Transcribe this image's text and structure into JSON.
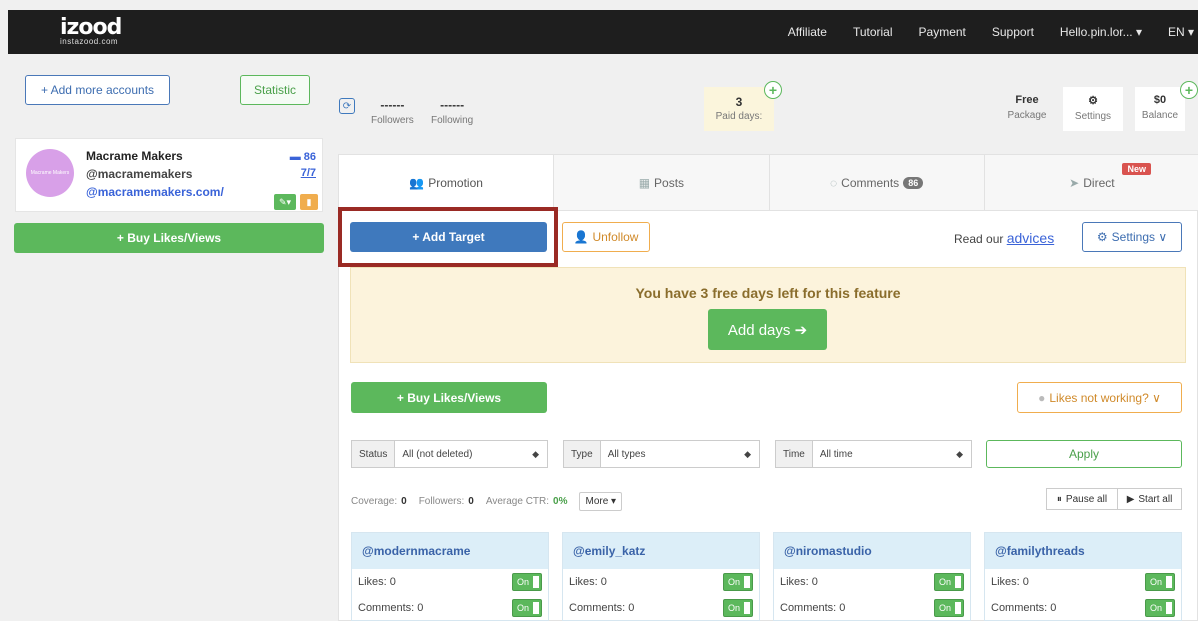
{
  "brand": {
    "logo": "izood",
    "site": "instazood.com"
  },
  "nav": {
    "affiliate": "Affiliate",
    "tutorial": "Tutorial",
    "payment": "Payment",
    "support": "Support",
    "user": "Hello.pin.lor... ▾",
    "lang": "EN ▾"
  },
  "left": {
    "add_accounts": "+ Add more accounts",
    "statistic": "Statistic",
    "account": {
      "avatar_text": "Macrame Makers",
      "name": "Macrame Makers",
      "handle": "@macramemakers",
      "link": "@macramemakers.com/",
      "messages": "86",
      "ratio": "7/7"
    },
    "buy_likes": "+ Buy Likes/Views"
  },
  "stats": {
    "followers_value": "------",
    "followers_label": "Followers",
    "following_value": "------",
    "following_label": "Following",
    "paid_value": "3",
    "paid_label": "Paid days:",
    "package_value": "Free",
    "package_label": "Package",
    "settings_label": "Settings",
    "balance_value": "$0",
    "balance_label": "Balance"
  },
  "tabs": {
    "promotion": "Promotion",
    "posts": "Posts",
    "comments": "Comments",
    "comments_count": "86",
    "direct": "Direct",
    "new_badge": "New"
  },
  "toolbar": {
    "add_target": "+ Add Target",
    "unfollow": "Unfollow",
    "read_our": "Read our",
    "advices": "advices",
    "settings": "Settings ∨"
  },
  "notice": {
    "text": "You have 3 free days left for this feature",
    "add_days": "Add days ➔"
  },
  "buy_likes_main": "+ Buy Likes/Views",
  "likes_not_working": "Likes not working? ∨",
  "filters": {
    "status_label": "Status",
    "status_value": "All (not deleted)",
    "type_label": "Type",
    "type_value": "All types",
    "time_label": "Time",
    "time_value": "All time",
    "apply": "Apply"
  },
  "coverage": {
    "coverage_label": "Coverage:",
    "coverage_value": "0",
    "followers_label": "Followers:",
    "followers_value": "0",
    "ctr_label": "Average CTR:",
    "ctr_value": "0%",
    "more": "More ▾",
    "pause_all": "Pause all",
    "start_all": "Start all"
  },
  "cards": [
    {
      "handle": "@modernmacrame",
      "likes": "Likes: 0",
      "comments": "Comments: 0",
      "toggle": "On"
    },
    {
      "handle": "@emily_katz",
      "likes": "Likes: 0",
      "comments": "Comments: 0",
      "toggle": "On"
    },
    {
      "handle": "@niromastudio",
      "likes": "Likes: 0",
      "comments": "Comments: 0",
      "toggle": "On"
    },
    {
      "handle": "@familythreads",
      "likes": "Likes: 0",
      "comments": "Comments: 0",
      "toggle": "On"
    }
  ],
  "colors": {
    "topbar": "#1e1e1e",
    "green": "#5cb85c",
    "blue": "#3f79bd",
    "highlight": "#9a2a24",
    "notice_bg": "#fcf3dc"
  }
}
